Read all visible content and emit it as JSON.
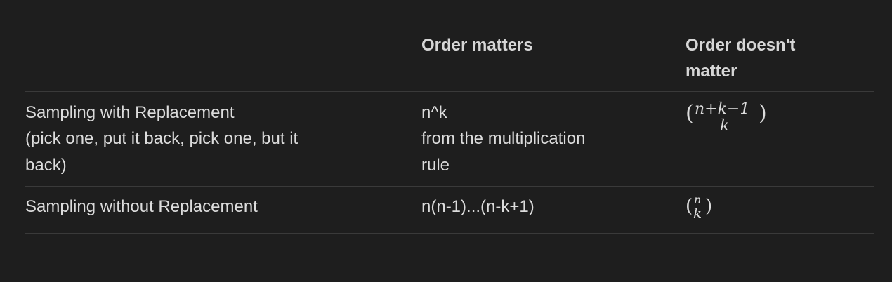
{
  "table": {
    "headers": {
      "blank": "",
      "order_matters": "Order matters",
      "order_doesnt_1": "Order doesn't",
      "order_doesnt_2": "matter"
    },
    "rows": [
      {
        "label_lines": [
          "Sampling with Replacement",
          "(pick one, put it back, pick one, but it",
          "back)"
        ],
        "order_matters_lines": [
          "n^k",
          "from the multiplication",
          "rule"
        ],
        "order_doesnt": {
          "top": "n+k−1",
          "bottom": "k"
        }
      },
      {
        "label_lines": [
          "Sampling without Replacement"
        ],
        "order_matters_lines": [
          "n(n-1)...(n-k+1)"
        ],
        "order_doesnt": {
          "top": "n",
          "bottom": "k"
        }
      }
    ]
  }
}
